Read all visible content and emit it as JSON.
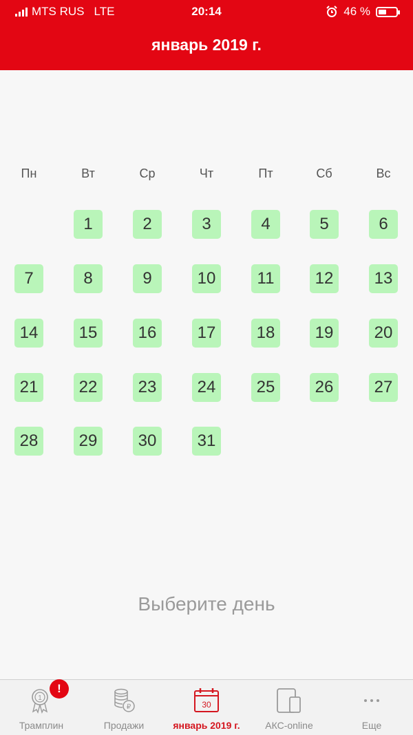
{
  "status_bar": {
    "carrier": "MTS RUS",
    "network": "LTE",
    "time": "20:14",
    "battery": "46 %",
    "battery_level": 0.46
  },
  "header": {
    "title": "январь 2019 г.",
    "color": "#e30613"
  },
  "calendar": {
    "weekdays": [
      "Пн",
      "Вт",
      "Ср",
      "Чт",
      "Пт",
      "Сб",
      "Вс"
    ],
    "days": [
      "1",
      "2",
      "3",
      "4",
      "5",
      "6",
      "7",
      "8",
      "9",
      "10",
      "11",
      "12",
      "13",
      "14",
      "15",
      "16",
      "17",
      "18",
      "19",
      "20",
      "21",
      "22",
      "23",
      "24",
      "25",
      "26",
      "27",
      "28",
      "29",
      "30",
      "31"
    ],
    "first_weekday_index": 1,
    "day_color": "#b9f5b9"
  },
  "hint": "Выберите день",
  "tabbar": {
    "tabs": [
      {
        "label": "Трамплин",
        "icon": "medal-icon",
        "badge": "!"
      },
      {
        "label": "Продажи",
        "icon": "coins-icon"
      },
      {
        "label": "январь 2019 г.",
        "icon": "calendar-icon",
        "icon_text": "30",
        "active": true
      },
      {
        "label": "АКС-online",
        "icon": "devices-icon"
      },
      {
        "label": "Еще",
        "icon": "more-icon"
      }
    ],
    "active_color": "#d4161f"
  }
}
